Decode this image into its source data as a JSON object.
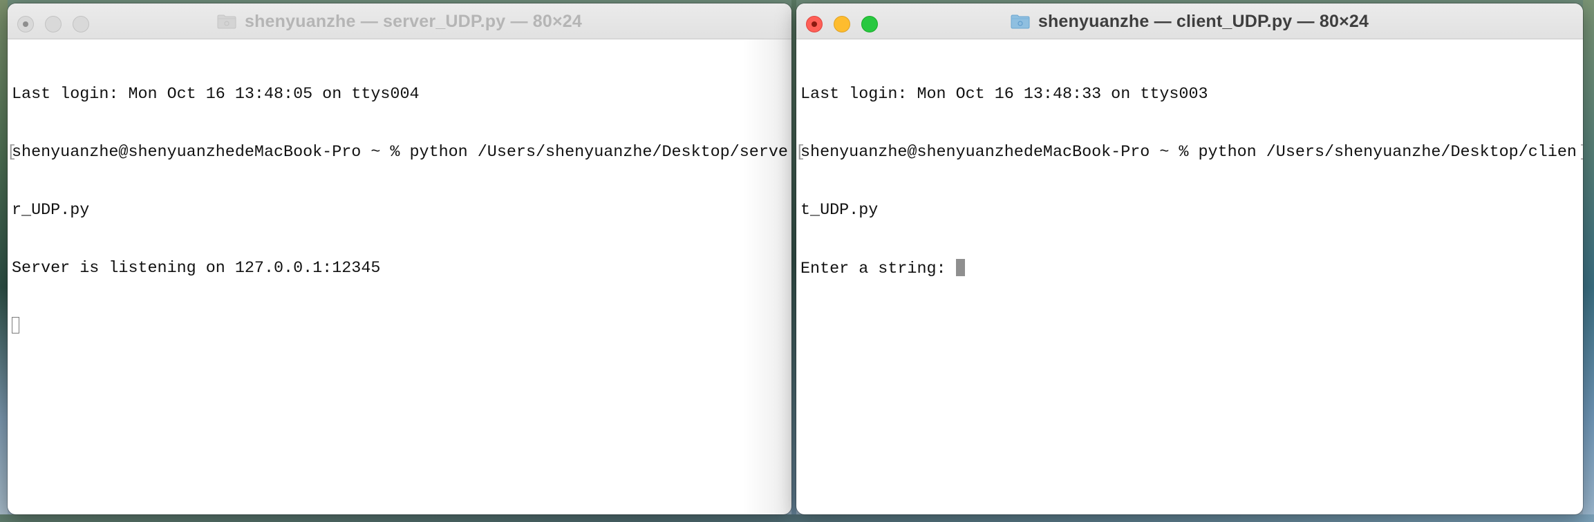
{
  "server_window": {
    "title": "shenyuanzhe — server_UDP.py — 80×24",
    "lines": [
      "Last login: Mon Oct 16 13:48:05 on ttys004",
      "shenyuanzhe@shenyuanzhedeMacBook-Pro ~ % python /Users/shenyuanzhe/Desktop/serve",
      "r_UDP.py",
      "Server is listening on 127.0.0.1:12345"
    ]
  },
  "client_window": {
    "title": "shenyuanzhe — client_UDP.py — 80×24",
    "lines": [
      "Last login: Mon Oct 16 13:48:33 on ttys003",
      "shenyuanzhe@shenyuanzhedeMacBook-Pro ~ % python /Users/shenyuanzhe/Desktop/clien",
      "t_UDP.py",
      "Enter a string: "
    ]
  },
  "icons": {
    "folder": "folder-icon",
    "close": "close-button-icon",
    "minimize": "minimize-button-icon",
    "zoom": "zoom-button-icon"
  },
  "colors": {
    "close": "#fe5f57",
    "minimize": "#febc2e",
    "zoom": "#28c840",
    "folder": "#8fbfe0"
  }
}
